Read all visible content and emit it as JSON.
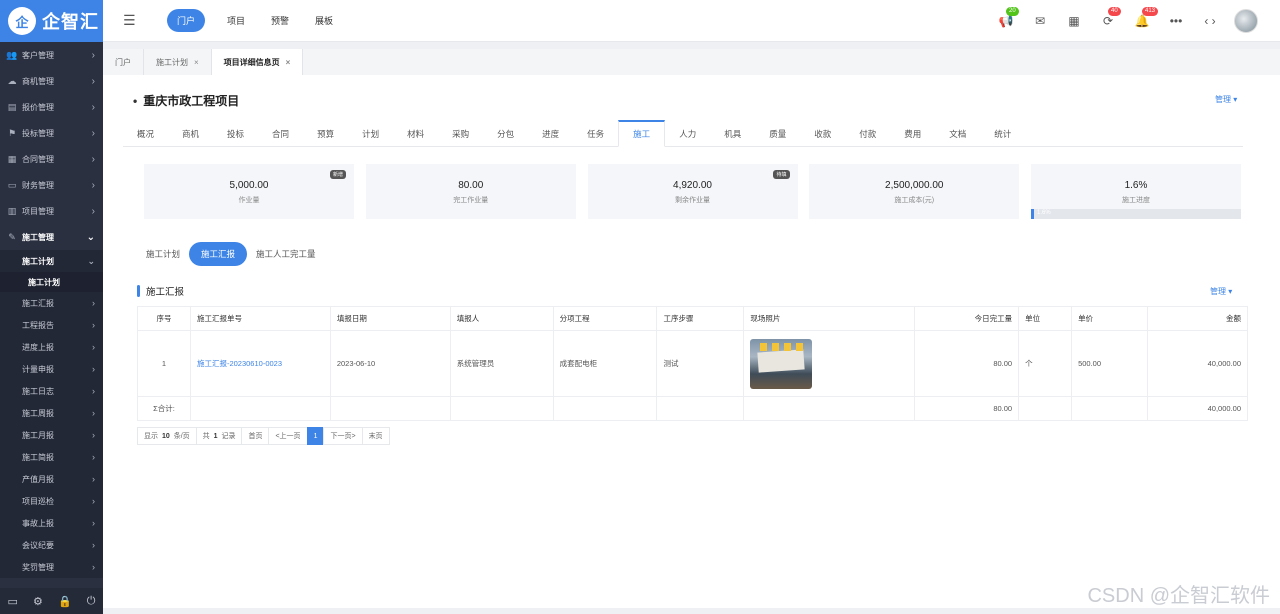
{
  "brand": {
    "logo_mark": "企",
    "name": "企智汇"
  },
  "sidebar": {
    "menu": [
      {
        "label": "客户管理",
        "icon": "users-icon"
      },
      {
        "label": "商机管理",
        "icon": "cloud-icon"
      },
      {
        "label": "报价管理",
        "icon": "clipboard-icon"
      },
      {
        "label": "投标管理",
        "icon": "flag-icon"
      },
      {
        "label": "合同管理",
        "icon": "contract-icon"
      },
      {
        "label": "财务管理",
        "icon": "wallet-icon"
      },
      {
        "label": "项目管理",
        "icon": "table-icon"
      },
      {
        "label": "施工管理",
        "icon": "wrench-icon"
      }
    ],
    "sub_open": "施工计划",
    "sub_sub": "施工计划",
    "sub_items": [
      "施工汇报",
      "工程报告",
      "进度上报",
      "计量申报",
      "施工日志",
      "施工周报",
      "施工月报",
      "施工简报",
      "产值月报",
      "项目巡检",
      "事故上报",
      "会议纪要",
      "奖罚管理"
    ]
  },
  "topbar": {
    "nav": [
      "门户",
      "项目",
      "预警",
      "展板"
    ],
    "badges": {
      "notify": "20",
      "sync": "40",
      "bell": "413"
    }
  },
  "tabs": [
    {
      "label": "门户",
      "closable": false
    },
    {
      "label": "施工计划",
      "closable": true
    },
    {
      "label": "项目详细信息页",
      "closable": true
    }
  ],
  "project": {
    "title": "重庆市政工程项目",
    "manage": "管理",
    "sub_tabs": [
      "概况",
      "商机",
      "投标",
      "合同",
      "预算",
      "计划",
      "材料",
      "采购",
      "分包",
      "进度",
      "任务",
      "施工",
      "人力",
      "机具",
      "质量",
      "收款",
      "付款",
      "费用",
      "文档",
      "统计"
    ],
    "active_tab": "施工"
  },
  "stats": [
    {
      "value": "5,000.00",
      "label": "作业量",
      "tag": "新增"
    },
    {
      "value": "80.00",
      "label": "完工作业量",
      "tag": ""
    },
    {
      "value": "4,920.00",
      "label": "剩余作业量",
      "tag": "待填"
    },
    {
      "value": "2,500,000.00",
      "label": "施工成本(元)",
      "tag": ""
    },
    {
      "value": "1.6%",
      "label": "施工进度",
      "tag": "",
      "progress": 0.016,
      "progress_text": "1.6%"
    }
  ],
  "pill_tabs": [
    "施工计划",
    "施工汇报",
    "施工人工完工量"
  ],
  "section": {
    "title": "施工汇报",
    "manage": "管理"
  },
  "table": {
    "headers": [
      "序号",
      "施工汇报单号",
      "填报日期",
      "填报人",
      "分项工程",
      "工序步骤",
      "现场照片",
      "今日完工量",
      "单位",
      "单价",
      "金额"
    ],
    "rows": [
      {
        "no": "1",
        "code": "施工汇报-20230610-0023",
        "date": "2023-06-10",
        "reporter": "系统管理员",
        "item": "成套配电柜",
        "step": "测试",
        "qty": "80.00",
        "unit": "个",
        "price": "500.00",
        "amount": "40,000.00"
      }
    ],
    "sum": {
      "label": "Σ合计:",
      "qty": "80.00",
      "amount": "40,000.00"
    }
  },
  "pager": {
    "show": "显示",
    "size": "10",
    "per": "条/页",
    "total_prefix": "共",
    "total": "1",
    "total_suffix": "记录",
    "first": "首页",
    "prev": "<上一页",
    "current": "1",
    "next": "下一页>",
    "last": "末页"
  },
  "watermark": "CSDN @企智汇软件"
}
